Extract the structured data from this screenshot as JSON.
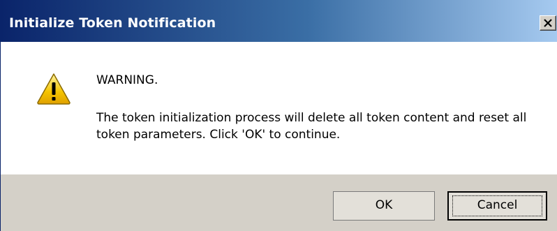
{
  "window": {
    "title": "Initialize Token Notification",
    "close_label": "X"
  },
  "message": {
    "heading": "WARNING.",
    "body": "The token initialization process will delete all token content and reset all token parameters. Click 'OK' to continue.",
    "icon": "warning-icon"
  },
  "buttons": {
    "ok_label": "OK",
    "cancel_label": "Cancel"
  },
  "colors": {
    "titlebar_start": "#0a246a",
    "titlebar_end": "#a6caf0",
    "footer_bg": "#d4d0c8",
    "warning_yellow": "#f5c400"
  }
}
